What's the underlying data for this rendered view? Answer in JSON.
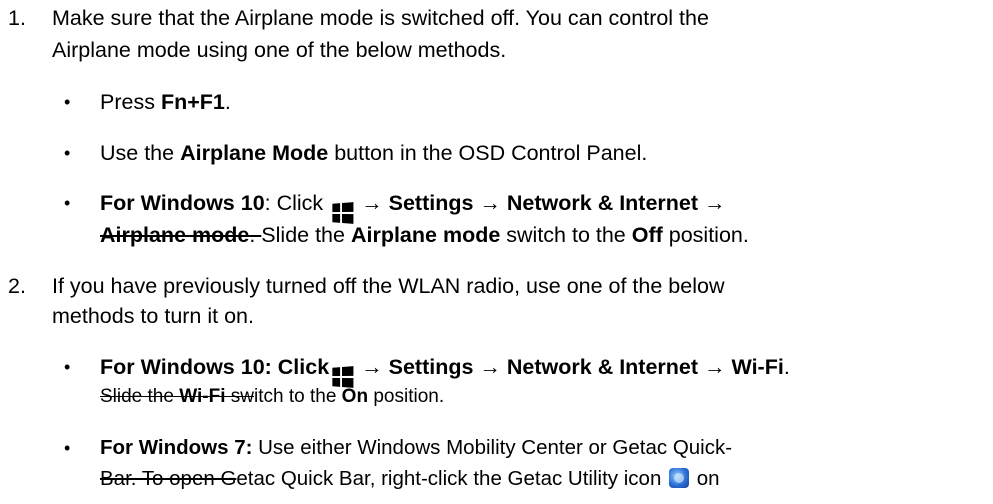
{
  "steps": [
    {
      "number": "1.",
      "lines": [
        "Make sure that the Airplane mode is switched off. You can control the",
        "Airplane mode using one of the below methods."
      ],
      "bullets": [
        {
          "t1": "Press ",
          "b1": "Fn+F1",
          "t2": "."
        },
        {
          "t1": "Use the ",
          "b1": "Airplane Mode",
          "t2": " button in the OSD Control Panel."
        },
        {
          "b1": "For Windows 10",
          "t1": ": Click ",
          "arrow1": " → ",
          "b2": "Settings",
          "arrow2": " → ",
          "b3": "Network & Internet",
          "arrow3": " →",
          "s1": "Airplane mode",
          "s2": ". ",
          "t2": "Slide the ",
          "b4": "Airplane mode",
          "t3": " switch to the ",
          "b5": "Off",
          "t4": " position."
        }
      ]
    },
    {
      "number": "2.",
      "lines": [
        "If you have previously turned off the WLAN radio, use one of the below",
        "methods to turn it on."
      ],
      "bullets": [
        {
          "b1": "For Windows 10: Click",
          "b2": " → Settings → Network & Internet → Wi-Fi",
          "t1": ".",
          "s1": "Slide the ",
          "s2": "Wi-Fi",
          "s3": " sw",
          "t2": "itch to the ",
          "b3": "On",
          "t3": " position."
        },
        {
          "b1": "For Windows 7:",
          "t1": " Use either Windows Mobility Center or Getac Quick-",
          "s1": "Bar. To open G",
          "t2": "etac Quick Bar, right-click the Getac Utility icon ",
          "t3": " on"
        }
      ]
    }
  ],
  "icons": {
    "windows": "windows-logo-icon",
    "getac": "getac-utility-icon"
  }
}
